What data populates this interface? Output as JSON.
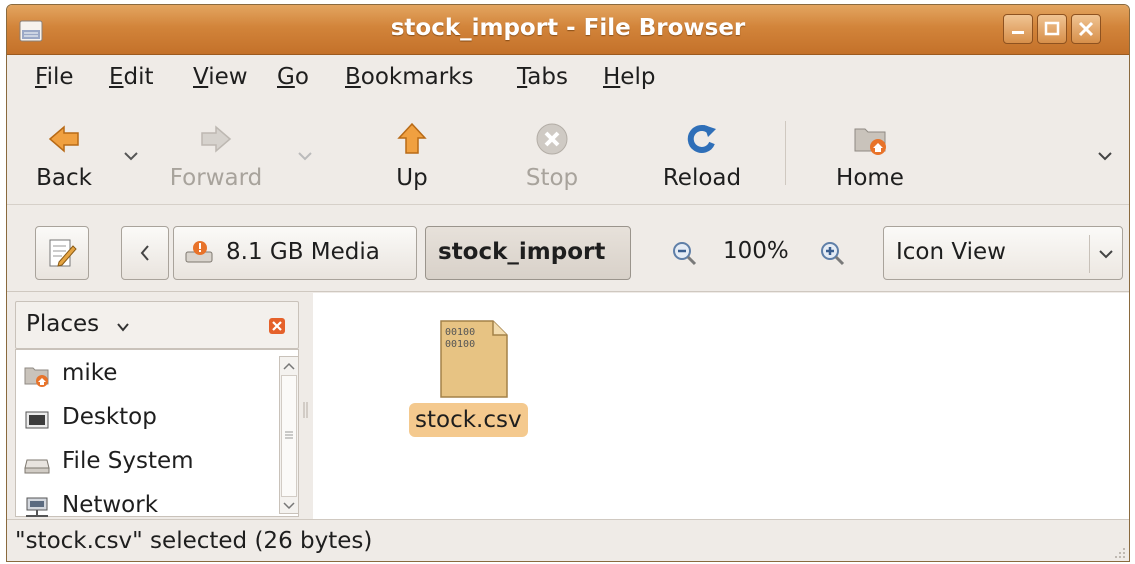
{
  "window": {
    "title": "stock_import - File Browser"
  },
  "menu": {
    "items": [
      {
        "pre": "",
        "mn": "F",
        "post": "ile"
      },
      {
        "pre": "",
        "mn": "E",
        "post": "dit"
      },
      {
        "pre": "",
        "mn": "V",
        "post": "iew"
      },
      {
        "pre": "",
        "mn": "G",
        "post": "o"
      },
      {
        "pre": "",
        "mn": "B",
        "post": "ookmarks"
      },
      {
        "pre": "",
        "mn": "T",
        "post": "abs"
      },
      {
        "pre": "",
        "mn": "H",
        "post": "elp"
      }
    ]
  },
  "toolbar": {
    "back": "Back",
    "forward": "Forward",
    "up": "Up",
    "stop": "Stop",
    "reload": "Reload",
    "home": "Home"
  },
  "location": {
    "path_root": "8.1 GB Media",
    "path_current": "stock_import",
    "zoom": "100%",
    "view_mode": "Icon View"
  },
  "sidebar": {
    "header": "Places",
    "items": [
      {
        "label": "mike",
        "icon": "home-folder-icon"
      },
      {
        "label": "Desktop",
        "icon": "desktop-icon"
      },
      {
        "label": "File System",
        "icon": "drive-icon"
      },
      {
        "label": "Network",
        "icon": "network-icon"
      }
    ]
  },
  "files": [
    {
      "name": "stock.csv",
      "icon_text_line1": "00100",
      "icon_text_line2": "00100",
      "selected": true
    }
  ],
  "status": {
    "text": "\"stock.csv\" selected (26 bytes)"
  },
  "colors": {
    "titlebar": "#d2843a",
    "selection": "#f4c98e",
    "window_bg": "#efebe7"
  }
}
